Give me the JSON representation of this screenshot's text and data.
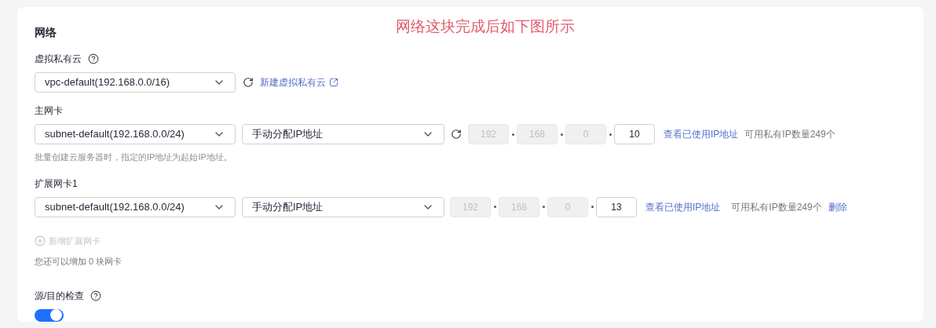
{
  "annotation": "网络这块完成后如下图所示",
  "section_title": "网络",
  "vpc": {
    "label": "虚拟私有云",
    "value": "vpc-default(192.168.0.0/16)",
    "link": "新建虚拟私有云"
  },
  "nics": [
    {
      "label": "主网卡",
      "subnet": "subnet-default(192.168.0.0/24)",
      "mode": "手动分配IP地址",
      "refresh": true,
      "octets": [
        {
          "value": "192",
          "disabled": true
        },
        {
          "value": "168",
          "disabled": true
        },
        {
          "value": "0",
          "disabled": true
        },
        {
          "value": "10",
          "disabled": false
        }
      ],
      "view_link": "查看已使用IP地址",
      "available": "可用私有IP数量249个",
      "hint": "批量创建云服务器时，指定的IP地址为起始IP地址。"
    },
    {
      "label": "扩展网卡1",
      "subnet": "subnet-default(192.168.0.0/24)",
      "mode": "手动分配IP地址",
      "refresh": false,
      "octets": [
        {
          "value": "192",
          "disabled": true
        },
        {
          "value": "168",
          "disabled": true
        },
        {
          "value": "0",
          "disabled": true
        },
        {
          "value": "13",
          "disabled": false
        }
      ],
      "view_link": "查看已使用IP地址",
      "available": "可用私有IP数量249个",
      "delete": "删除"
    }
  ],
  "add_nic": {
    "label": "新增扩展网卡",
    "disabled": true
  },
  "nic_quota": "您还可以增加 0 块网卡",
  "source_dest_check": {
    "label": "源/目的检查",
    "on": true
  }
}
